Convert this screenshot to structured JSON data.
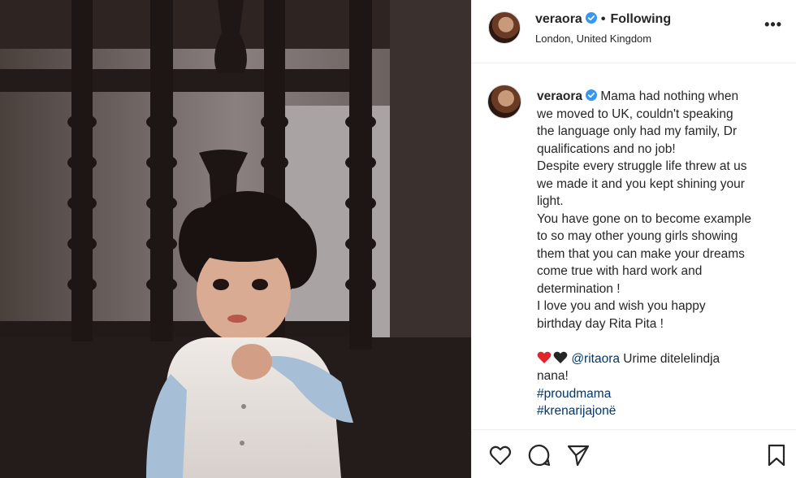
{
  "post": {
    "username": "veraora",
    "follow_status": "Following",
    "separator": "•",
    "location": "London, United Kingdom",
    "more_label": "•••"
  },
  "caption": {
    "username": "veraora",
    "lines": [
      "Mama had nothing when",
      "we moved to UK, couldn't speaking",
      "the language only had my family, Dr",
      "qualifications and no job!",
      "Despite every struggle life threw at us",
      "we made it and you kept shining your",
      "light.",
      "You have gone on to become example",
      "to so may other young girls showing",
      "them that you can make your dreams",
      "come true with hard work and",
      "determination !",
      "I love you and wish you happy",
      "birthday day Rita Pita !"
    ],
    "mention": "@ritaora",
    "mention_text": " Urime ditelelindja",
    "mention_text_2": "nana!",
    "hashtags": [
      "#proudmama",
      "#krenarijajonë"
    ]
  },
  "colors": {
    "verified": "#3897f0",
    "link": "#00376b",
    "heart_red": "#e0252c",
    "heart_black": "#262626"
  },
  "icons": [
    "verified-badge-icon",
    "red-heart-emoji",
    "black-heart-emoji",
    "like-heart-icon",
    "comment-icon",
    "share-icon",
    "save-bookmark-icon"
  ]
}
